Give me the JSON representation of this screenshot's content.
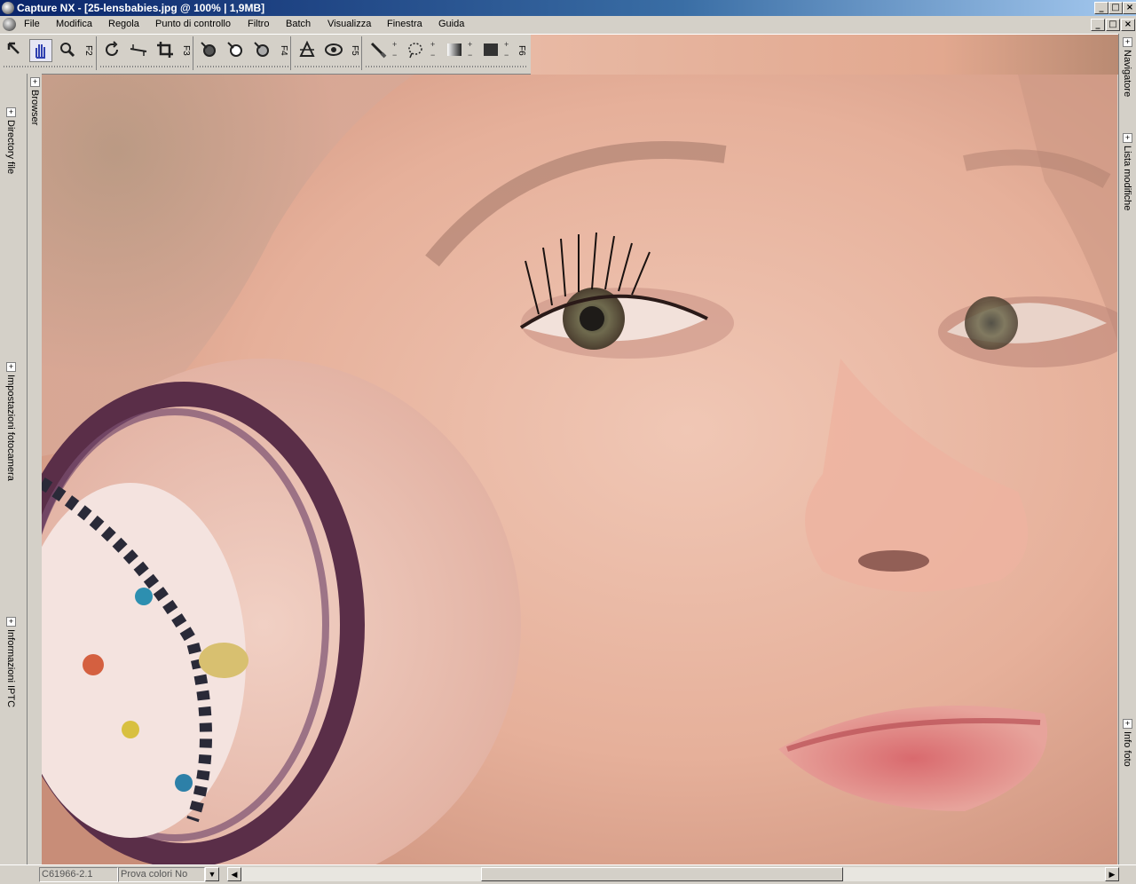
{
  "window": {
    "title": "Capture NX - [25-lensbabies.jpg @ 100% | 1,9MB]",
    "controls": [
      "_",
      "□",
      "×"
    ]
  },
  "menubar": {
    "items": [
      "File",
      "Modifica",
      "Regola",
      "Punto di controllo",
      "Filtro",
      "Batch",
      "Visualizza",
      "Finestra",
      "Guida"
    ]
  },
  "toolbar": {
    "groups": [
      {
        "fkey": "F2",
        "tools": [
          "direct-select-icon",
          "hand-icon",
          "zoom-icon"
        ]
      },
      {
        "fkey": "F3",
        "tools": [
          "rotate-icon",
          "straighten-icon",
          "crop-icon"
        ]
      },
      {
        "fkey": "F4",
        "tools": [
          "black-control-point-icon",
          "white-control-point-icon",
          "neutral-control-point-icon"
        ]
      },
      {
        "fkey": "F5",
        "tools": [
          "red-eye-icon",
          "eye-icon"
        ]
      },
      {
        "fkey": "F6",
        "tools": [
          "brush-icon",
          "lasso-icon",
          "gradient-icon",
          "fill-icon"
        ]
      }
    ],
    "active_tool": "hand-icon"
  },
  "left_dock": {
    "tabs": [
      "Directory file",
      "Impostazioni fotocamera",
      "Informazioni IPTC"
    ],
    "browser_tab": "Browser"
  },
  "right_dock": {
    "tabs": [
      "Navigatore",
      "Lista modifiche",
      "Info foto"
    ]
  },
  "statusbar": {
    "profile": "C61966-2.1",
    "soft_proof": "Prova colori No"
  },
  "image": {
    "filename": "25-lensbabies.jpg",
    "zoom": "100%",
    "size": "1,9MB"
  }
}
